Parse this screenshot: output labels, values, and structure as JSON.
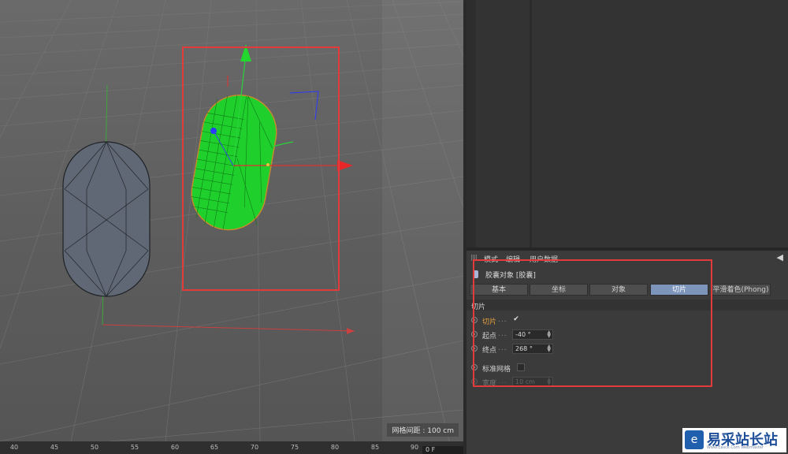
{
  "viewport": {
    "grid_spacing_label": "网格间距 : 100 cm"
  },
  "timeline": {
    "ticks": [
      "40",
      "45",
      "50",
      "55",
      "60",
      "65",
      "70",
      "75",
      "80",
      "85",
      "90"
    ],
    "frame_field": "0 F"
  },
  "attributes": {
    "menu": [
      "模式",
      "编辑",
      "用户数据"
    ],
    "object_title": "胶囊对象 [胶囊]",
    "tabs": [
      "基本",
      "坐标",
      "对象",
      "切片",
      "平滑着色(Phong)"
    ],
    "active_tab": "切片",
    "section_title": "切片",
    "params": {
      "slice": {
        "label": "切片",
        "dots": "...",
        "checked": "✔"
      },
      "start": {
        "label": "起点",
        "dots": "...",
        "value": "-40 °"
      },
      "end": {
        "label": "终点",
        "dots": "...",
        "value": "268 °"
      },
      "std_grid": {
        "label": "标准网格",
        "checked": ""
      },
      "width": {
        "label": "宽度",
        "dots": "...",
        "value": "10 cm"
      }
    }
  },
  "colors": {
    "accent_tab": "#7e95bb",
    "highlight_box": "#e23b3b",
    "selected_object": "#1ed42a"
  },
  "watermark": {
    "text": "易采站长站",
    "sub": "Www.Easck.Com  Webmaster"
  }
}
